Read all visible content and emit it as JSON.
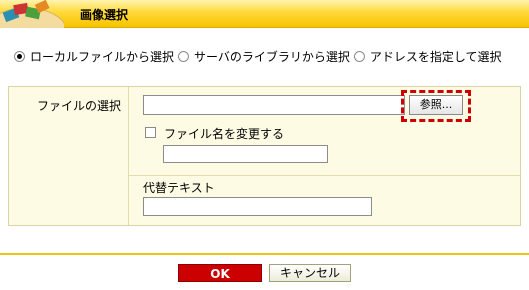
{
  "dialog": {
    "title": "画像選択"
  },
  "source_options": [
    {
      "label": "ローカルファイルから選択",
      "selected": true
    },
    {
      "label": "サーバのライブラリから選択",
      "selected": false
    },
    {
      "label": "アドレスを指定して選択",
      "selected": false
    }
  ],
  "file_section": {
    "label": "ファイルの選択",
    "file_value": "",
    "browse_label": "参照...",
    "rename_checkbox_label": "ファイル名を変更する",
    "rename_checked": false,
    "rename_value": ""
  },
  "alt_section": {
    "label": "代替テキスト",
    "value": ""
  },
  "buttons": {
    "ok": "OK",
    "cancel": "キャンセル"
  },
  "colors": {
    "title_bar": "#ffd93a",
    "panel_bg": "#fdfbe4",
    "ok_button": "#cc0000",
    "highlight": "#cc0000",
    "footer_line": "#f1c31a"
  },
  "icons": {
    "logo": "books-logo-icon"
  }
}
